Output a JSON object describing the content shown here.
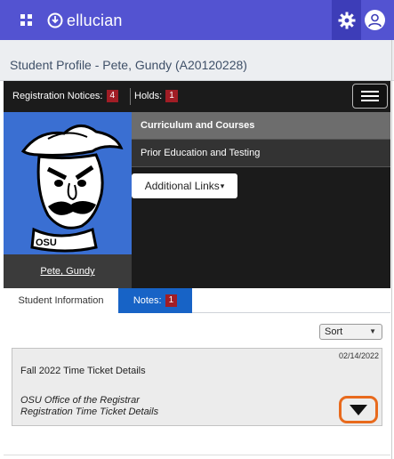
{
  "topbar": {
    "brand": "ellucian",
    "colors": {
      "bar": "#5353d1",
      "gear_area": "#3d3db8"
    },
    "icons": [
      "apps-grid-icon",
      "ellucian-logo-icon",
      "gear-icon",
      "user-avatar-icon"
    ]
  },
  "page": {
    "title": "Student Profile - Pete, Gundy (A20120228)"
  },
  "notices": {
    "registration_label": "Registration Notices:",
    "registration_count": "4",
    "holds_label": "Holds:",
    "holds_count": "1",
    "badge_color": "#a11d25"
  },
  "profile": {
    "student_name": "Pete, Gundy",
    "photo_caption": "OSU",
    "photo_bg": "#3a6fd2",
    "links": [
      {
        "label": "Curriculum and Courses",
        "active": true
      },
      {
        "label": "Prior Education and Testing",
        "active": false
      }
    ],
    "additional_links_label": "Additional Links"
  },
  "tabs": {
    "student_info_label": "Student Information",
    "notes_label": "Notes:",
    "notes_count": "1",
    "active_color": "#1763c6"
  },
  "notes": {
    "sort_label": "Sort",
    "items": [
      {
        "date": "02/14/2022",
        "title": "Fall 2022 Time Ticket Details",
        "origin": "OSU Office of the Registrar",
        "detail": "Registration Time Ticket Details"
      }
    ],
    "expand_highlight_color": "#e86a1d"
  }
}
